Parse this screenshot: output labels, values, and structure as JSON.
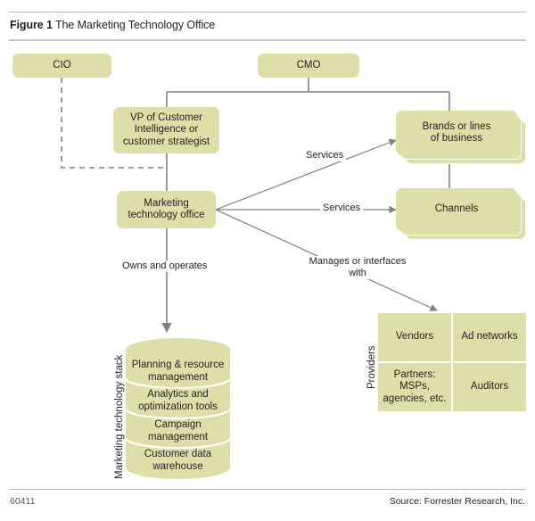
{
  "figure": {
    "label": "Figure 1",
    "title": "The Marketing Technology Office"
  },
  "footer": {
    "id": "60411",
    "source": "Source: Forrester Research, Inc."
  },
  "colors": {
    "node_fill": "#dedfa8",
    "connector": "#808285",
    "rule": "#b9b9b9",
    "text": "#231f20"
  },
  "nodes": {
    "cio": "CIO",
    "cmo": "CMO",
    "vp": "VP of Customer Intelligence or customer strategist",
    "vp_lines": [
      "VP of Customer",
      "Intelligence or",
      "customer strategist"
    ],
    "mto": "Marketing technology office",
    "mto_lines": [
      "Marketing",
      "technology office"
    ],
    "brands": "Brands or lines of business",
    "brands_lines": [
      "Brands or lines",
      "of business"
    ],
    "channels": "Channels"
  },
  "edge_labels": {
    "services_brands": "Services",
    "services_channels": "Services",
    "owns_operates": "Owns and operates",
    "manages_interfaces": "Manages or interfaces with",
    "manages_interfaces_lines": [
      "Manages or interfaces",
      "with"
    ]
  },
  "stack": {
    "caption": "Marketing technology stack",
    "layers": [
      "Planning & resource management",
      "Analytics and optimization tools",
      "Campaign management",
      "Customer data warehouse"
    ],
    "layers_lines": [
      [
        "Planning & resource",
        "management"
      ],
      [
        "Analytics and",
        "optimization tools"
      ],
      [
        "Campaign",
        "management"
      ],
      [
        "Customer data",
        "warehouse"
      ]
    ]
  },
  "providers": {
    "caption": "Providers",
    "cells": [
      "Vendors",
      "Ad networks",
      "Partners: MSPs, agencies, etc.",
      "Auditors"
    ],
    "cells_lines": [
      [
        "Vendors"
      ],
      [
        "Ad networks"
      ],
      [
        "Partners:",
        "MSPs,",
        "agencies, etc."
      ],
      [
        "Auditors"
      ]
    ]
  }
}
